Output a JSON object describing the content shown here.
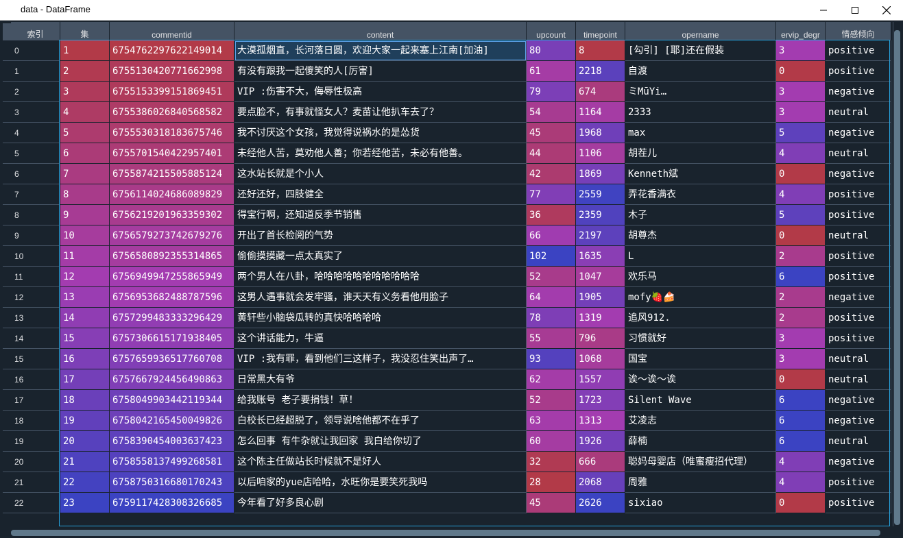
{
  "window": {
    "title": "data - DataFrame"
  },
  "columns": [
    "索引",
    "集",
    "commentid",
    "content",
    "upcount",
    "timepoint",
    "opername",
    "ervip_degr",
    "情感倾向"
  ],
  "rows": [
    {
      "index": "0",
      "ji": "1",
      "commentid": "6754762297622149014",
      "content": "大漠孤烟直，长河落日圆，欢迎大家一起来塞上江南[加油]",
      "upcount": "80",
      "timepoint": "8",
      "opername": "[勾引] [耶]还在假装",
      "ervip": "3",
      "sentiment": "positive"
    },
    {
      "index": "1",
      "ji": "2",
      "commentid": "6755130420771662998",
      "content": "有没有跟我一起傻笑的人[厉害]",
      "upcount": "61",
      "timepoint": "2218",
      "opername": "自渡",
      "ervip": "0",
      "sentiment": "positive"
    },
    {
      "index": "2",
      "ji": "3",
      "commentid": "6755153399151869451",
      "content": "VIP :伤害不大，侮辱性极高",
      "upcount": "79",
      "timepoint": "674",
      "opername": "ミMūYi…",
      "ervip": "3",
      "sentiment": "negative"
    },
    {
      "index": "3",
      "ji": "4",
      "commentid": "6755386026840568582",
      "content": "要点脸不，有事就怪女人？麦苗让他扒车去了？",
      "upcount": "54",
      "timepoint": "1164",
      "opername": "2333",
      "ervip": "3",
      "sentiment": "neutral"
    },
    {
      "index": "4",
      "ji": "5",
      "commentid": "6755530318183675746",
      "content": "我不讨厌这个女孩，我觉得说祸水的是怂货",
      "upcount": "45",
      "timepoint": "1968",
      "opername": "max",
      "ervip": "5",
      "sentiment": "negative"
    },
    {
      "index": "5",
      "ji": "6",
      "commentid": "6755701540422957401",
      "content": "未经他人苦，莫劝他人善；你若经他苦，未必有他善。",
      "upcount": "44",
      "timepoint": "1106",
      "opername": "胡茬儿",
      "ervip": "4",
      "sentiment": "neutral"
    },
    {
      "index": "6",
      "ji": "7",
      "commentid": "6755874215505885124",
      "content": "这水站长就是个小人",
      "upcount": "42",
      "timepoint": "1869",
      "opername": "Kenneth斌",
      "ervip": "0",
      "sentiment": "negative"
    },
    {
      "index": "7",
      "ji": "8",
      "commentid": "6756114024686089829",
      "content": "还好还好，四肢健全",
      "upcount": "77",
      "timepoint": "2559",
      "opername": "弄花香满衣",
      "ervip": "4",
      "sentiment": "positive"
    },
    {
      "index": "8",
      "ji": "9",
      "commentid": "6756219201963359302",
      "content": "得宝行啊，还知道反季节销售",
      "upcount": "36",
      "timepoint": "2359",
      "opername": "木子",
      "ervip": "5",
      "sentiment": "positive"
    },
    {
      "index": "9",
      "ji": "10",
      "commentid": "6756579273742679276",
      "content": "开出了首长检阅的气势",
      "upcount": "66",
      "timepoint": "2197",
      "opername": "胡尊杰",
      "ervip": "0",
      "sentiment": "neutral"
    },
    {
      "index": "10",
      "ji": "11",
      "commentid": "6756580892355314865",
      "content": "偷偷摸摸藏一点太真实了",
      "upcount": "102",
      "timepoint": "1635",
      "opername": "L",
      "ervip": "2",
      "sentiment": "positive"
    },
    {
      "index": "11",
      "ji": "12",
      "commentid": "6756949947255865949",
      "content": "两个男人在八卦，哈哈哈哈哈哈哈哈哈哈哈",
      "upcount": "52",
      "timepoint": "1047",
      "opername": "欢乐马",
      "ervip": "6",
      "sentiment": "positive"
    },
    {
      "index": "12",
      "ji": "13",
      "commentid": "6756953682488787596",
      "content": "这男人遇事就会发牢骚，谁天天有义务看他用脸子",
      "upcount": "64",
      "timepoint": "1905",
      "opername": "mofy🍓🍰",
      "ervip": "2",
      "sentiment": "negative"
    },
    {
      "index": "13",
      "ji": "14",
      "commentid": "6757299483333296429",
      "content": "黄轩些小脑袋瓜转的真快哈哈哈哈",
      "upcount": "78",
      "timepoint": "1319",
      "opername": "追风912.",
      "ervip": "2",
      "sentiment": "positive"
    },
    {
      "index": "14",
      "ji": "15",
      "commentid": "6757306615171938405",
      "content": "这个讲话能力，牛逼",
      "upcount": "55",
      "timepoint": "796",
      "opername": "习惯就好",
      "ervip": "3",
      "sentiment": "positive"
    },
    {
      "index": "15",
      "ji": "16",
      "commentid": "6757659936517760708",
      "content": "VIP :我有罪，看到他们三这样子，我没忍住笑出声了…",
      "upcount": "93",
      "timepoint": "1068",
      "opername": "国宝",
      "ervip": "3",
      "sentiment": "neutral"
    },
    {
      "index": "16",
      "ji": "17",
      "commentid": "6757667924456490863",
      "content": "日常黑大有爷",
      "upcount": "62",
      "timepoint": "1557",
      "opername": "诶～诶～诶",
      "ervip": "0",
      "sentiment": "neutral"
    },
    {
      "index": "17",
      "ji": "18",
      "commentid": "6758049903442119344",
      "content": "给我账号 老子要捐钱！草！",
      "upcount": "52",
      "timepoint": "1723",
      "opername": "Silent Wave",
      "ervip": "6",
      "sentiment": "negative"
    },
    {
      "index": "18",
      "ji": "19",
      "commentid": "6758042165450049826",
      "content": "白校长已经超脱了，领导说啥他都不在乎了",
      "upcount": "63",
      "timepoint": "1313",
      "opername": "艾凌志",
      "ervip": "6",
      "sentiment": "negative"
    },
    {
      "index": "19",
      "ji": "20",
      "commentid": "6758390454003637423",
      "content": "怎么回事 有牛杂就让我回家 我白给你切了",
      "upcount": "60",
      "timepoint": "1926",
      "opername": "薛楠",
      "ervip": "6",
      "sentiment": "neutral"
    },
    {
      "index": "20",
      "ji": "21",
      "commentid": "6758558137499268581",
      "content": "这个陈主任做站长时候就不是好人",
      "upcount": "32",
      "timepoint": "666",
      "opername": "聪妈母婴店（唯蜜瘦招代理）",
      "ervip": "4",
      "sentiment": "negative"
    },
    {
      "index": "21",
      "ji": "22",
      "commentid": "6758750316680170243",
      "content": "以后咱家的yue店哈哈，水旺你是要笑死我吗",
      "upcount": "28",
      "timepoint": "2068",
      "opername": "周雅",
      "ervip": "4",
      "sentiment": "positive"
    },
    {
      "index": "22",
      "ji": "23",
      "commentid": "6759117428308326685",
      "content": "今年看了好多良心剧",
      "upcount": "45",
      "timepoint": "2626",
      "opername": "sixiao",
      "ervip": "0",
      "sentiment": "positive"
    }
  ],
  "colors": {
    "background": "#19232d",
    "header": "#455364",
    "selection_border": "#26a0da",
    "heat_low": "#b23a48",
    "heat_mid": "#a33cb0",
    "heat_high": "#3b43c2"
  }
}
